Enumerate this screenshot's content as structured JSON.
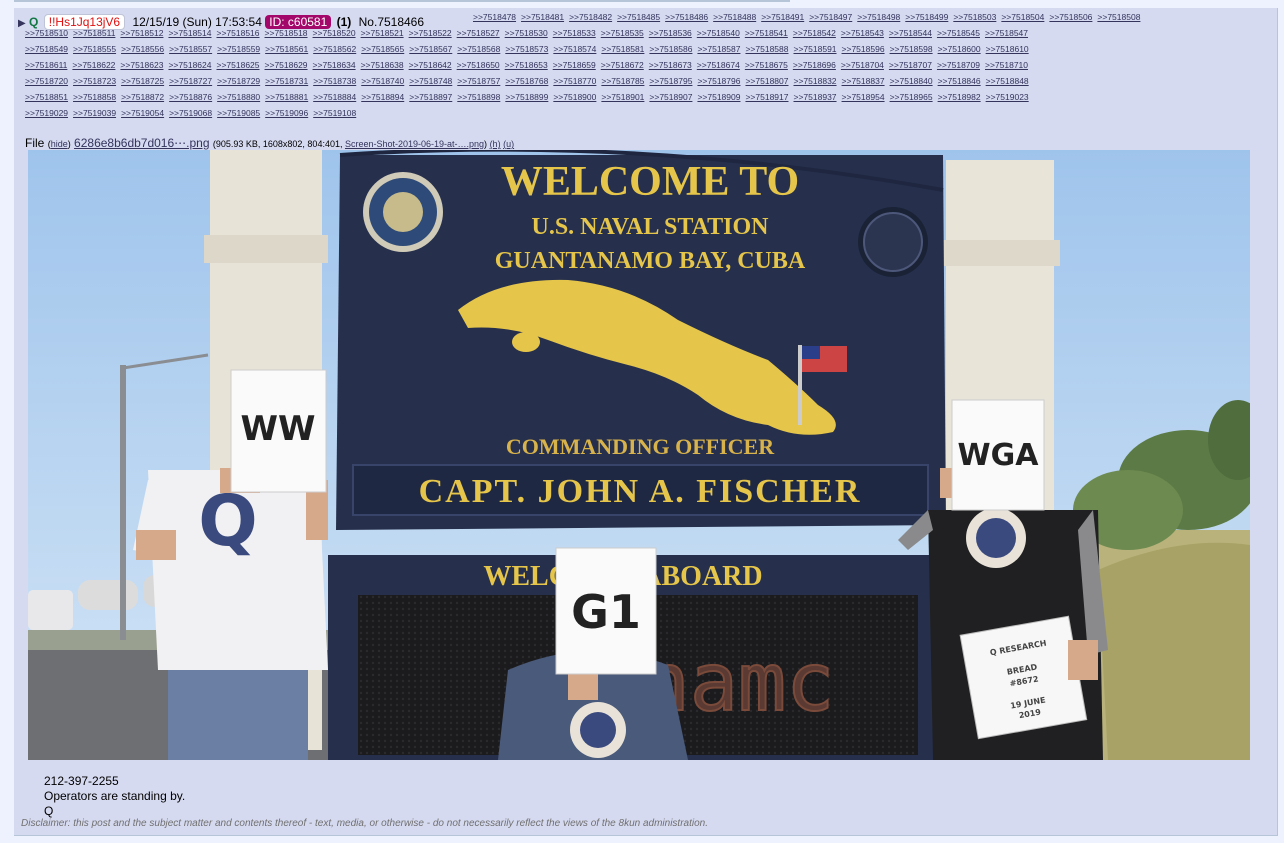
{
  "post": {
    "arrow": "▶",
    "name": "Q",
    "tripcode": "!!Hs1Jq13jV6",
    "datetime": "12/15/19 (Sun) 17:53:54",
    "id": "ID: c60581",
    "count": "(1)",
    "number": "No.7518466"
  },
  "replies": [
    [
      ">>7518478",
      ">>7518481",
      ">>7518482",
      ">>7518485",
      ">>7518486",
      ">>7518488",
      ">>7518491",
      ">>7518497",
      ">>7518498",
      ">>7518499",
      ">>7518503",
      ">>7518504",
      ">>7518506",
      ">>7518508"
    ],
    [
      ">>7518510",
      ">>7518511",
      ">>7518512",
      ">>7518514",
      ">>7518516",
      ">>7518518",
      ">>7518520",
      ">>7518521",
      ">>7518522",
      ">>7518527",
      ">>7518530",
      ">>7518533",
      ">>7518535",
      ">>7518536",
      ">>7518540",
      ">>7518541",
      ">>7518542",
      ">>7518543",
      ">>7518544",
      ">>7518545",
      ">>7518547"
    ],
    [
      ">>7518549",
      ">>7518555",
      ">>7518556",
      ">>7518557",
      ">>7518559",
      ">>7518561",
      ">>7518562",
      ">>7518565",
      ">>7518567",
      ">>7518568",
      ">>7518573",
      ">>7518574",
      ">>7518581",
      ">>7518586",
      ">>7518587",
      ">>7518588",
      ">>7518591",
      ">>7518596",
      ">>7518598",
      ">>7518600",
      ">>7518610"
    ],
    [
      ">>7518611",
      ">>7518622",
      ">>7518623",
      ">>7518624",
      ">>7518625",
      ">>7518629",
      ">>7518634",
      ">>7518638",
      ">>7518642",
      ">>7518650",
      ">>7518653",
      ">>7518659",
      ">>7518672",
      ">>7518673",
      ">>7518674",
      ">>7518675",
      ">>7518696",
      ">>7518704",
      ">>7518707",
      ">>7518709",
      ">>7518710"
    ],
    [
      ">>7518720",
      ">>7518723",
      ">>7518725",
      ">>7518727",
      ">>7518729",
      ">>7518731",
      ">>7518738",
      ">>7518740",
      ">>7518748",
      ">>7518757",
      ">>7518768",
      ">>7518770",
      ">>7518785",
      ">>7518795",
      ">>7518796",
      ">>7518807",
      ">>7518832",
      ">>7518837",
      ">>7518840",
      ">>7518846",
      ">>7518848"
    ],
    [
      ">>7518851",
      ">>7518858",
      ">>7518872",
      ">>7518876",
      ">>7518880",
      ">>7518881",
      ">>7518884",
      ">>7518894",
      ">>7518897",
      ">>7518898",
      ">>7518899",
      ">>7518900",
      ">>7518901",
      ">>7518907",
      ">>7518909",
      ">>7518917",
      ">>7518937",
      ">>7518954",
      ">>7518965",
      ">>7518982",
      ">>7519023"
    ],
    [
      ">>7519029",
      ">>7519039",
      ">>7519054",
      ">>7519068",
      ">>7519085",
      ">>7519096",
      ">>7519108"
    ]
  ],
  "file": {
    "label": "File",
    "hide": "hide",
    "filename": "6286e8b6db7d016⋯.png",
    "meta_prefix": "(905.93 KB, 1608x802, 804:401, ",
    "original_name": "Screen-Shot-2019-06-19-at-….png",
    "meta_suffix": ")",
    "h": "(h)",
    "u": "(u)"
  },
  "image": {
    "sign_welcome": "WELCOME TO",
    "sign_station": "U.S. NAVAL STATION",
    "sign_location": "GUANTANAMO BAY, CUBA",
    "sign_co": "COMMANDING OFFICER",
    "sign_name": "CAPT. JOHN A. FISCHER",
    "sign_aboard": "WELCOME ABOARD",
    "led_text": "namc",
    "card_left": "WW",
    "card_center": "G1",
    "card_right": "WGA",
    "card_small_1": "Q RESEARCH",
    "card_small_2": "BREAD",
    "card_small_3": "#8672",
    "card_small_4": "19 JUNE",
    "card_small_5": "2019",
    "shirt_q": "Q"
  },
  "message": {
    "line1": "212-397-2255",
    "line2": "Operators are standing by.",
    "line3": "Q"
  },
  "disclaimer": "Disclaimer: this post and the subject matter and contents thereof - text, media, or otherwise - do not necessarily reflect the views of the 8kun administration.",
  "colors": {
    "post_bg": "#d6daf0",
    "id_bg": "#a3076a",
    "trip": "#e01010",
    "name": "#117743",
    "link": "#34345c",
    "sign_navy": "#26304d",
    "sign_gold": "#e5c54a"
  }
}
